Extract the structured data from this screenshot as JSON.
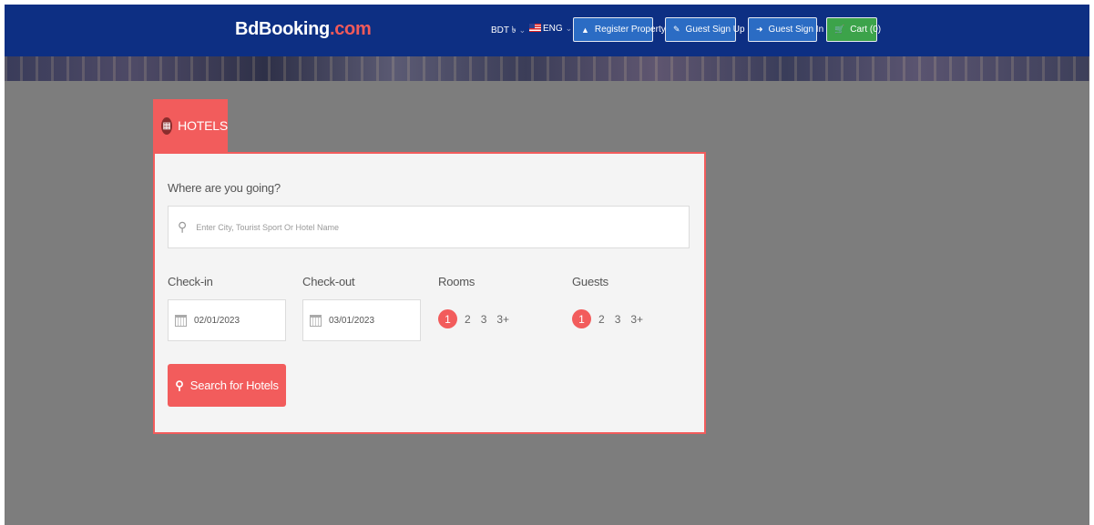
{
  "header": {
    "logo_main": "BdBooking",
    "logo_tld": ".com",
    "currency": "BDT ৳",
    "language": "ENG",
    "register_property": "Register Property",
    "guest_sign_up": "Guest Sign Up",
    "guest_sign_in": "Guest Sign In",
    "cart": "Cart (0)",
    "colors": {
      "nav": "#0d2f83",
      "accent": "#f15a5a",
      "button_blue": "#2b6cc4",
      "button_green": "#3ca34a"
    }
  },
  "tab": {
    "label": "HOTELS",
    "icon": "hotel-building-icon"
  },
  "search_form": {
    "destination_label": "Where are you going?",
    "destination_placeholder": "Enter City, Tourist Sport Or Hotel Name",
    "destination_value": "",
    "checkin_label": "Check-in",
    "checkin_value": "02/01/2023",
    "checkout_label": "Check-out",
    "checkout_value": "03/01/2023",
    "rooms_label": "Rooms",
    "rooms_options": [
      "1",
      "2",
      "3",
      "3+"
    ],
    "rooms_selected": "1",
    "guests_label": "Guests",
    "guests_options": [
      "1",
      "2",
      "3",
      "3+"
    ],
    "guests_selected": "1",
    "submit_label": "Search for Hotels",
    "accent_color": "#f25c5c"
  }
}
